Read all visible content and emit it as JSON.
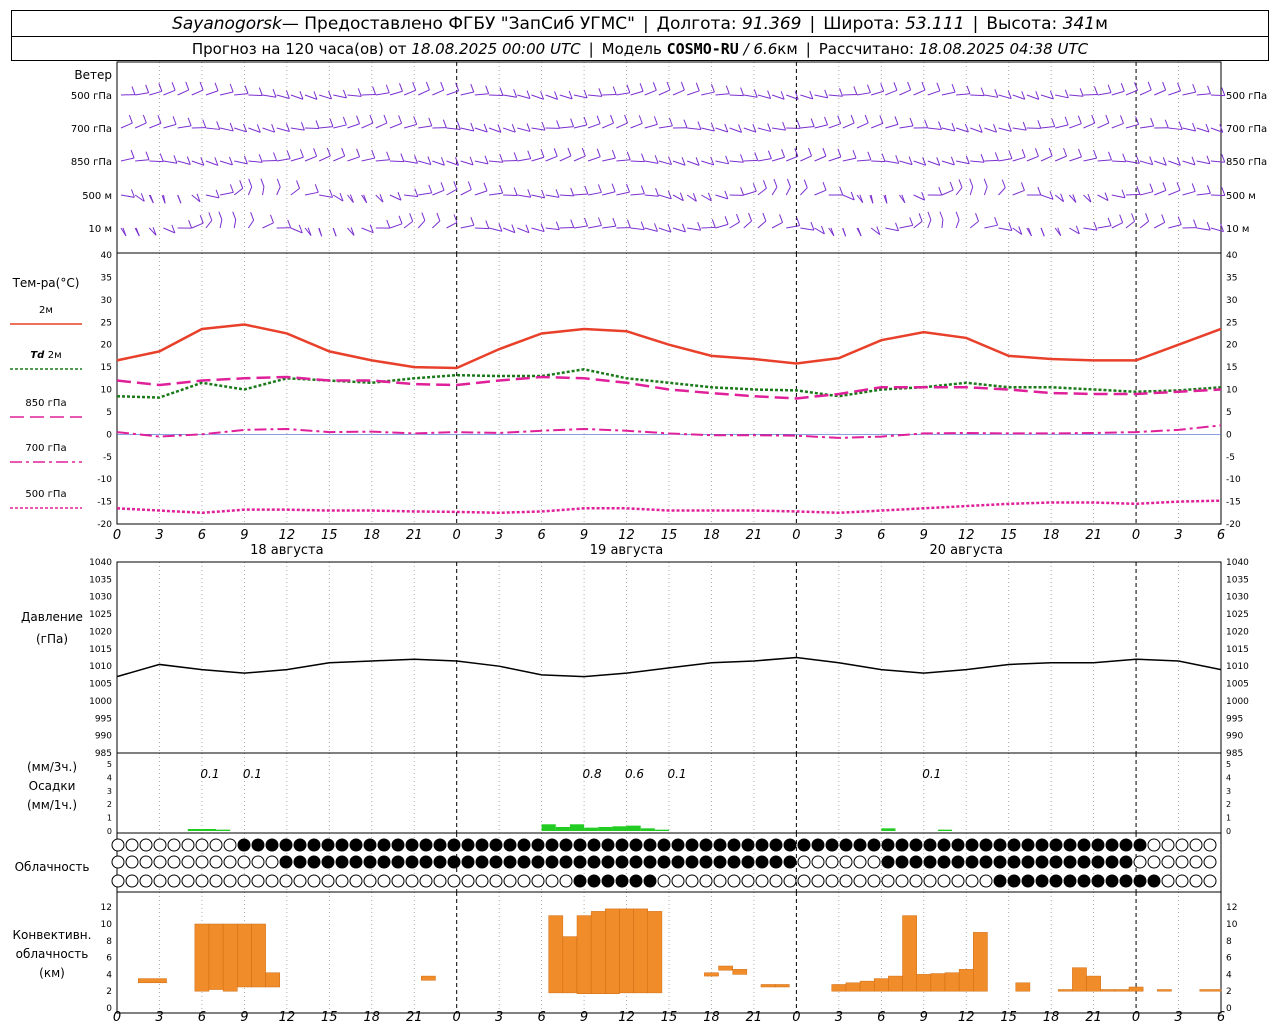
{
  "header": {
    "station": "Sayanogorsk",
    "provider": " — Предоставлено ФГБУ \"ЗапСиб УГМС\"",
    "lon_label": "Долгота:",
    "lon_value": "91.369",
    "lat_label": "Широта:",
    "lat_value": "53.111",
    "alt_label": "Высота:",
    "alt_value": "341",
    "alt_unit": "м",
    "forecast_prefix": "Прогноз на 120 часа(ов) от",
    "forecast_from": "18.08.2025 00:00 UTC",
    "model_label": "Модель",
    "model_name": "COSMO-RU",
    "model_res": "/ 6.6",
    "model_res_unit": "км",
    "calc_label": "Рассчитано:",
    "calc_time": "18.08.2025 04:38 UTC"
  },
  "hour_ticks": [
    "0",
    "3",
    "6",
    "9",
    "12",
    "15",
    "18",
    "21",
    "0",
    "3",
    "6",
    "9",
    "12",
    "15",
    "18",
    "21",
    "0",
    "3",
    "6",
    "9",
    "12",
    "15",
    "18",
    "21",
    "0",
    "3",
    "6"
  ],
  "day_labels": [
    "18 августа",
    "19 августа",
    "20 августа"
  ],
  "wind_panel": {
    "title": "Ветер",
    "levels": [
      "500 гПа",
      "700 гПа",
      "850 гПа",
      "500 м",
      "10 м"
    ],
    "barb_color": "#7b2fd0"
  },
  "temp_panel": {
    "title": "Тем-ра(°С)",
    "legend": [
      {
        "label": "2м",
        "italic": "",
        "color": "#e8402a"
      },
      {
        "label": "2м",
        "italic": "Td",
        "color": "#1a7a1a"
      },
      {
        "label": "850 гПа",
        "italic": "",
        "color": "#e0209a"
      },
      {
        "label": "700 гПа",
        "italic": "",
        "color": "#e0209a"
      },
      {
        "label": "500 гПа",
        "italic": "",
        "color": "#e0209a"
      }
    ],
    "yticks": [
      "40",
      "35",
      "30",
      "25",
      "20",
      "15",
      "10",
      "5",
      "0",
      "-5",
      "-10",
      "-15",
      "-20"
    ]
  },
  "pressure_panel": {
    "title": "Давление",
    "unit": "(гПа)",
    "yticks": [
      "1040",
      "1035",
      "1030",
      "1025",
      "1020",
      "1015",
      "1010",
      "1005",
      "1000",
      "995",
      "990",
      "985"
    ]
  },
  "precip_panel": {
    "unit3h": "(мм/3ч.)",
    "title": "Осадки",
    "unit1h": "(мм/1ч.)",
    "yticks": [
      "5",
      "4",
      "3",
      "2",
      "1",
      "0"
    ],
    "labels": [
      {
        "h": 6,
        "text": "0.1"
      },
      {
        "h": 9,
        "text": "0.1"
      },
      {
        "h": 33,
        "text": "0.8"
      },
      {
        "h": 36,
        "text": "0.6"
      },
      {
        "h": 39,
        "text": "0.1"
      },
      {
        "h": 57,
        "text": "0.1"
      }
    ]
  },
  "cloud_panel": {
    "title": "Облачность"
  },
  "conv_panel": {
    "title1": "Конвективн.",
    "title2": "облачность",
    "unit": "(км)",
    "yticks": [
      "12",
      "10",
      "8",
      "6",
      "4",
      "2",
      "0"
    ]
  },
  "chart_data": [
    {
      "type": "line",
      "title": "Тем-ра(°С)",
      "xlabel": "",
      "ylabel": "Тем-ра(°С)",
      "ylim": [
        -20,
        40
      ],
      "x": [
        0,
        3,
        6,
        9,
        12,
        15,
        18,
        21,
        24,
        27,
        30,
        33,
        36,
        39,
        42,
        45,
        48,
        51,
        54,
        57,
        60,
        63,
        66,
        69,
        72,
        75,
        78
      ],
      "series": [
        {
          "name": "2м",
          "color": "#e8402a",
          "values": [
            16.5,
            18.5,
            23.5,
            24.5,
            22.5,
            18.5,
            16.5,
            15,
            14.8,
            19,
            22.5,
            23.5,
            23,
            20,
            17.5,
            16.8,
            15.8,
            17,
            21,
            22.8,
            21.5,
            17.5,
            16.8,
            16.5,
            16.5,
            20,
            23.5
          ]
        },
        {
          "name": "Td 2м",
          "color": "#1a7a1a",
          "values": [
            8.5,
            8.2,
            11.5,
            10,
            12.5,
            12,
            11.5,
            12.5,
            13.2,
            13,
            13,
            14.5,
            12.5,
            11.5,
            10.5,
            10,
            9.8,
            8.5,
            10,
            10.5,
            11.5,
            10.5,
            10.5,
            10,
            9.5,
            9.8,
            10.5
          ]
        },
        {
          "name": "850 гПа",
          "color": "#e0209a",
          "values": [
            12,
            11,
            12,
            12.5,
            12.8,
            12,
            12,
            11.2,
            11,
            12,
            12.8,
            12.5,
            11.5,
            10,
            9.2,
            8.5,
            8,
            9,
            10.5,
            10.5,
            10.5,
            10,
            9.2,
            9,
            9,
            9.5,
            10
          ]
        },
        {
          "name": "700 гПа",
          "color": "#e0209a",
          "values": [
            0.5,
            -0.5,
            0,
            1,
            1.2,
            0.5,
            0.6,
            0.2,
            0.5,
            0.3,
            0.8,
            1.2,
            0.8,
            0.2,
            -0.2,
            -0.2,
            -0.3,
            -0.8,
            -0.5,
            0.2,
            0.3,
            0.2,
            0.2,
            0.3,
            0.5,
            1,
            2
          ]
        },
        {
          "name": "500 гПа",
          "color": "#e0209a",
          "values": [
            -16.5,
            -17,
            -17.5,
            -16.8,
            -16.8,
            -17,
            -17,
            -17.2,
            -17.3,
            -17.5,
            -17.2,
            -16.5,
            -16.5,
            -17,
            -17,
            -17,
            -17.2,
            -17.5,
            -17,
            -16.5,
            -16,
            -15.5,
            -15.2,
            -15.2,
            -15.5,
            -15,
            -14.8
          ]
        }
      ]
    },
    {
      "type": "line",
      "title": "Давление",
      "ylabel": "Давление (гПа)",
      "ylim": [
        985,
        1040
      ],
      "x": [
        0,
        3,
        6,
        9,
        12,
        15,
        18,
        21,
        24,
        27,
        30,
        33,
        36,
        39,
        42,
        45,
        48,
        51,
        54,
        57,
        60,
        63,
        66,
        69,
        72,
        75,
        78
      ],
      "series": [
        {
          "name": "",
          "color": "#000000",
          "values": [
            1007,
            1010.5,
            1009,
            1008,
            1009,
            1011,
            1011.5,
            1012,
            1011.5,
            1010,
            1007.5,
            1007,
            1008,
            1009.5,
            1011,
            1011.5,
            1012.5,
            1011,
            1009,
            1008,
            1009,
            1010.5,
            1011,
            1011,
            1012,
            1011.5,
            1009
          ]
        }
      ]
    },
    {
      "type": "bar",
      "title": "Осадки",
      "ylabel": "(мм/1ч.)",
      "ylim": [
        0,
        5
      ],
      "x": [
        5,
        6,
        7,
        30,
        31,
        32,
        33,
        34,
        35,
        36,
        37,
        38,
        54,
        58
      ],
      "values": [
        0.15,
        0.15,
        0.1,
        0.5,
        0.3,
        0.5,
        0.25,
        0.3,
        0.35,
        0.4,
        0.2,
        0.1,
        0.2,
        0.1
      ]
    },
    {
      "type": "bar",
      "title": "Конвективн. облачность (км)",
      "ylabel": "(км)",
      "ylim": [
        0,
        13
      ],
      "bars": [
        {
          "x0": 1.5,
          "x1": 3.5,
          "base": 3,
          "top": 3.5
        },
        {
          "x0": 5.5,
          "x1": 6.5,
          "base": 2,
          "top": 10
        },
        {
          "x0": 6.5,
          "x1": 7.5,
          "base": 2.2,
          "top": 10
        },
        {
          "x0": 7.5,
          "x1": 8.5,
          "base": 2,
          "top": 10
        },
        {
          "x0": 8.5,
          "x1": 9.5,
          "base": 2.5,
          "top": 10
        },
        {
          "x0": 9.5,
          "x1": 10.5,
          "base": 2.5,
          "top": 10
        },
        {
          "x0": 10.5,
          "x1": 11.5,
          "base": 2.5,
          "top": 4.2
        },
        {
          "x0": 21.5,
          "x1": 22.5,
          "base": 3.3,
          "top": 3.8
        },
        {
          "x0": 30.5,
          "x1": 31.5,
          "base": 1.8,
          "top": 11
        },
        {
          "x0": 31.5,
          "x1": 32.5,
          "base": 1.8,
          "top": 8.5
        },
        {
          "x0": 32.5,
          "x1": 33.5,
          "base": 1.7,
          "top": 11
        },
        {
          "x0": 33.5,
          "x1": 34.5,
          "base": 1.7,
          "top": 11.5
        },
        {
          "x0": 34.5,
          "x1": 35.5,
          "base": 1.7,
          "top": 11.8
        },
        {
          "x0": 35.5,
          "x1": 36.5,
          "base": 1.8,
          "top": 11.8
        },
        {
          "x0": 36.5,
          "x1": 37.5,
          "base": 1.8,
          "top": 11.8
        },
        {
          "x0": 37.5,
          "x1": 38.5,
          "base": 1.8,
          "top": 11.5
        },
        {
          "x0": 41.5,
          "x1": 42.5,
          "base": 3.8,
          "top": 4.2
        },
        {
          "x0": 42.5,
          "x1": 43.5,
          "base": 4.5,
          "top": 5
        },
        {
          "x0": 43.5,
          "x1": 44.5,
          "base": 4,
          "top": 4.6
        },
        {
          "x0": 45.5,
          "x1": 46.5,
          "base": 2.5,
          "top": 2.8
        },
        {
          "x0": 46.5,
          "x1": 47.5,
          "base": 2.5,
          "top": 2.8
        },
        {
          "x0": 50.5,
          "x1": 51.5,
          "base": 2,
          "top": 2.8
        },
        {
          "x0": 51.5,
          "x1": 52.5,
          "base": 2,
          "top": 3
        },
        {
          "x0": 52.5,
          "x1": 53.5,
          "base": 2,
          "top": 3.2
        },
        {
          "x0": 53.5,
          "x1": 54.5,
          "base": 2,
          "top": 3.5
        },
        {
          "x0": 54.5,
          "x1": 55.5,
          "base": 2,
          "top": 3.8
        },
        {
          "x0": 55.5,
          "x1": 56.5,
          "base": 2,
          "top": 11
        },
        {
          "x0": 56.5,
          "x1": 57.5,
          "base": 2,
          "top": 4
        },
        {
          "x0": 57.5,
          "x1": 58.5,
          "base": 2,
          "top": 4.1
        },
        {
          "x0": 58.5,
          "x1": 59.5,
          "base": 2,
          "top": 4.2
        },
        {
          "x0": 59.5,
          "x1": 60.5,
          "base": 2,
          "top": 4.6
        },
        {
          "x0": 60.5,
          "x1": 61.5,
          "base": 2,
          "top": 9
        },
        {
          "x0": 63.5,
          "x1": 64.5,
          "base": 2,
          "top": 3
        },
        {
          "x0": 66.5,
          "x1": 67.5,
          "base": 2,
          "top": 2.2
        },
        {
          "x0": 67.5,
          "x1": 68.5,
          "base": 2,
          "top": 4.8
        },
        {
          "x0": 68.5,
          "x1": 69.5,
          "base": 2,
          "top": 3.8
        },
        {
          "x0": 69.5,
          "x1": 70.5,
          "base": 2,
          "top": 2.2
        },
        {
          "x0": 70.5,
          "x1": 71.5,
          "base": 2,
          "top": 2.2
        },
        {
          "x0": 71.5,
          "x1": 72.5,
          "base": 2,
          "top": 2.5
        },
        {
          "x0": 73.5,
          "x1": 74.5,
          "base": 2,
          "top": 2.2
        },
        {
          "x0": 76.5,
          "x1": 78,
          "base": 2,
          "top": 2.2
        }
      ]
    }
  ]
}
